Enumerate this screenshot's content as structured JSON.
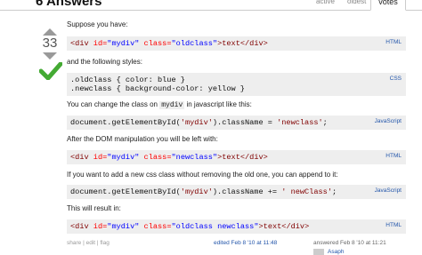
{
  "header": {
    "answers_count": "6 Answers",
    "tabs": [
      {
        "label": "active"
      },
      {
        "label": "oldest"
      },
      {
        "label": "votes"
      }
    ]
  },
  "vote": {
    "count": "33",
    "accepted": true
  },
  "post": {
    "p1": "Suppose you have:",
    "code1": {
      "tag_open": "<div ",
      "id_attr": "id=",
      "id_val": "\"mydiv\"",
      "class_attr": " class=",
      "class_val": "\"oldclass\"",
      "rest": ">text</div>",
      "lang": "HTML"
    },
    "p2": "and the following styles:",
    "code2": {
      "line1": ".oldclass { color: blue }",
      "line2": ".newclass { background-color: yellow }",
      "lang": "CSS"
    },
    "p3_before": "You can change the class on ",
    "p3_code": "mydiv",
    "p3_after": " in javascript like this:",
    "code3": {
      "pre": "document.getElementById(",
      "arg": "'mydiv'",
      "mid": ").className = ",
      "val": "'newclass'",
      "end": ";",
      "lang": "JavaScript"
    },
    "p4": "After the DOM manipulation you will be left with:",
    "code4": {
      "tag_open": "<div ",
      "id_attr": "id=",
      "id_val": "\"mydiv\"",
      "class_attr": " class=",
      "class_val": "\"newclass\"",
      "rest": ">text</div>",
      "lang": "HTML"
    },
    "p5": "If you want to add a new css class without removing the old one, you can append to it:",
    "code5": {
      "pre": "document.getElementById(",
      "arg": "'mydiv'",
      "mid": ").className += ",
      "val": "' newClass'",
      "end": ";",
      "lang": "JavaScript"
    },
    "p6": "This will result in:",
    "code6": {
      "tag_open": "<div ",
      "id_attr": "id=",
      "id_val": "\"mydiv\"",
      "class_attr": " class=",
      "class_val": "\"oldclass newclass\"",
      "rest": ">text</div>",
      "lang": "HTML"
    }
  },
  "footer": {
    "share": "share",
    "edit": "edit",
    "flag": "flag",
    "sep": " | ",
    "edited": "edited Feb 8 '10 at 11:48",
    "answered": "answered Feb 8 '10 at 11:21",
    "user": "Asaph"
  }
}
